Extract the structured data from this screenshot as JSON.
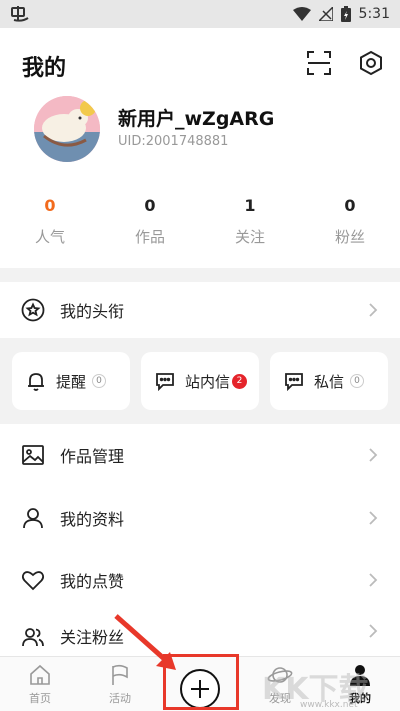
{
  "status_bar": {
    "time": "5:31"
  },
  "header": {
    "title": "我的"
  },
  "profile": {
    "username": "新用户_wZgARG",
    "uid": "UID:2001748881"
  },
  "stats": [
    {
      "value": "0",
      "label": "人气"
    },
    {
      "value": "0",
      "label": "作品"
    },
    {
      "value": "1",
      "label": "关注"
    },
    {
      "value": "0",
      "label": "粉丝"
    }
  ],
  "title_row": {
    "label": "我的头衔"
  },
  "quick_actions": [
    {
      "label": "提醒",
      "badge": "0"
    },
    {
      "label": "站内信",
      "badge": "2"
    },
    {
      "label": "私信",
      "badge": "0"
    }
  ],
  "menu": [
    {
      "label": "作品管理"
    },
    {
      "label": "我的资料"
    },
    {
      "label": "我的点赞"
    },
    {
      "label": "关注粉丝"
    }
  ],
  "tabbar": [
    {
      "label": "首页"
    },
    {
      "label": "活动"
    },
    {
      "label": ""
    },
    {
      "label": "发现"
    },
    {
      "label": "我的"
    }
  ],
  "watermark": {
    "text": "KK下载",
    "url": "www.kkx.net"
  },
  "colors": {
    "accent_hot": "#f26b1d",
    "badge_red": "#e5242b",
    "highlight": "#e8382a"
  }
}
